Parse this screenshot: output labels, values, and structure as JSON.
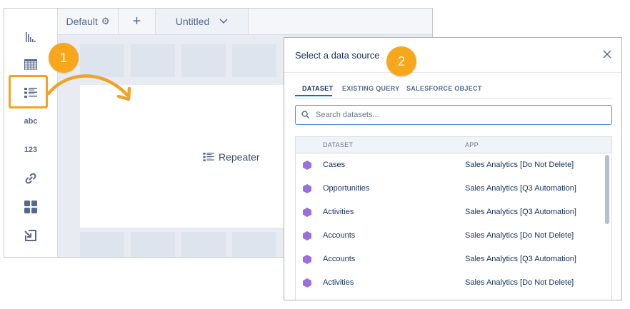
{
  "builder": {
    "tabs": [
      {
        "label": "Default"
      },
      {
        "label": "+"
      },
      {
        "label": "Untitled"
      }
    ],
    "left_toolbar": [
      {
        "icon": "chart-icon"
      },
      {
        "icon": "table-icon"
      },
      {
        "icon": "repeater-icon",
        "highlighted": true
      },
      {
        "icon": "text-icon",
        "label": "abc"
      },
      {
        "icon": "number-icon",
        "label": "123"
      },
      {
        "icon": "link-icon"
      },
      {
        "icon": "container-icon"
      },
      {
        "icon": "import-icon"
      }
    ],
    "widget_label": "Repeater"
  },
  "callouts": {
    "step1": "1",
    "step2": "2",
    "accent": "#f8a61c"
  },
  "modal": {
    "title": "Select a data source",
    "tabs": [
      "DATASET",
      "EXISTING QUERY",
      "SALESFORCE OBJECT"
    ],
    "active_tab": "DATASET",
    "search_placeholder": "Search datasets...",
    "columns": [
      "DATASET",
      "APP"
    ],
    "rows": [
      {
        "dataset": "Cases",
        "app": "Sales Analytics [Do Not Delete]"
      },
      {
        "dataset": "Opportunities",
        "app": "Sales Analytics [Q3 Automation]"
      },
      {
        "dataset": "Activities",
        "app": "Sales Analytics [Q3 Automation]"
      },
      {
        "dataset": "Accounts",
        "app": "Sales Analytics [Do Not Delete]"
      },
      {
        "dataset": "Accounts",
        "app": "Sales Analytics [Q3 Automation]"
      },
      {
        "dataset": "Activities",
        "app": "Sales Analytics [Do Not Delete]"
      }
    ],
    "dataset_icon_color": "#9b6fdc",
    "accent": "#0070d2"
  }
}
